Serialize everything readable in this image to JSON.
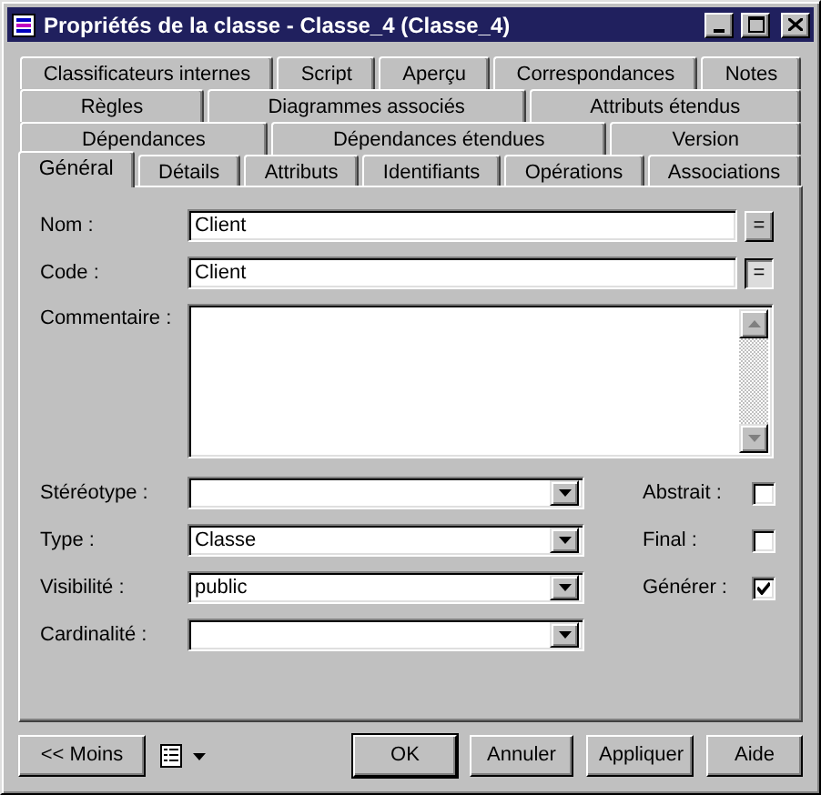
{
  "window": {
    "title": "Propriétés de la classe - Classe_4 (Classe_4)"
  },
  "tab_rows": [
    [
      {
        "label": "Classificateurs internes",
        "selected": false
      },
      {
        "label": "Script",
        "selected": false
      },
      {
        "label": "Aperçu",
        "selected": false
      },
      {
        "label": "Correspondances",
        "selected": false
      },
      {
        "label": "Notes",
        "selected": false
      }
    ],
    [
      {
        "label": "Règles",
        "selected": false
      },
      {
        "label": "Diagrammes associés",
        "selected": false
      },
      {
        "label": "Attributs étendus",
        "selected": false
      }
    ],
    [
      {
        "label": "Dépendances",
        "selected": false
      },
      {
        "label": "Dépendances étendues",
        "selected": false
      },
      {
        "label": "Version",
        "selected": false
      }
    ],
    [
      {
        "label": "Général",
        "selected": true
      },
      {
        "label": "Détails",
        "selected": false
      },
      {
        "label": "Attributs",
        "selected": false
      },
      {
        "label": "Identifiants",
        "selected": false
      },
      {
        "label": "Opérations",
        "selected": false
      },
      {
        "label": "Associations",
        "selected": false
      }
    ]
  ],
  "fields": [
    {
      "kind": "text",
      "label": "Nom :",
      "value": "Client",
      "button": "=",
      "pressed": false
    },
    {
      "kind": "text",
      "label": "Code :",
      "value": "Client",
      "button": "=",
      "pressed": true
    },
    {
      "kind": "memo",
      "label": "Commentaire :"
    }
  ],
  "combos": [
    {
      "label": "Stéréotype :"
    },
    {
      "label": "Type :",
      "value": "Classe"
    },
    {
      "label": "Visibilité :",
      "value": "public"
    },
    {
      "label": "Cardinalité :"
    }
  ],
  "checks": [
    {
      "label": "Abstrait :",
      "checked": false
    },
    {
      "label": "Final :",
      "checked": false
    },
    {
      "label": "Générer :",
      "checked": true
    }
  ],
  "footer": {
    "less_button": "<< Moins",
    "buttons": [
      {
        "label": "OK",
        "default": true
      },
      {
        "label": "Annuler",
        "default": false
      },
      {
        "label": "Appliquer",
        "default": false
      },
      {
        "label": "Aide",
        "default": false
      }
    ]
  }
}
